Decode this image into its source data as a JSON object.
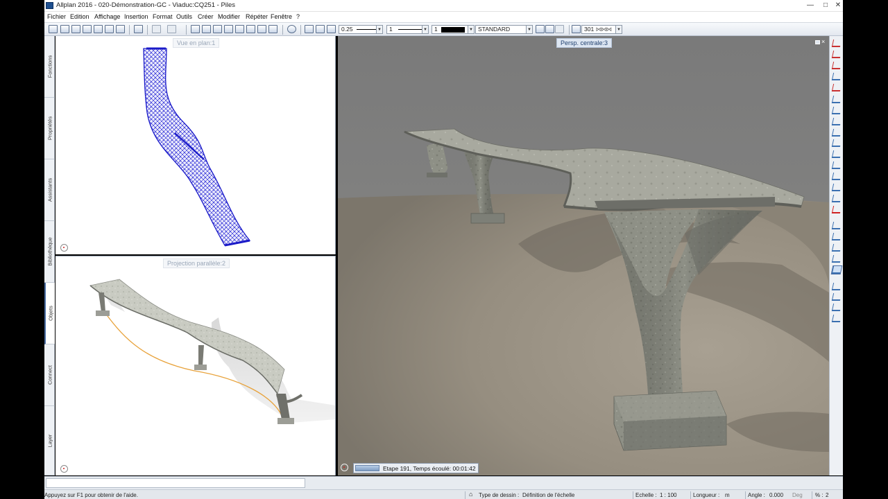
{
  "window": {
    "title": "Allplan 2016 - 020-Démonstration-GC - Viaduc:CQ251 - Piles",
    "controls": [
      "—",
      "□",
      "✕"
    ]
  },
  "menu": [
    "Fichier",
    "Edition",
    "Affichage",
    "Insertion",
    "Format",
    "Outils",
    "Créer",
    "Modifier",
    "Répéter",
    "Fenêtre",
    "?"
  ],
  "toolbar": {
    "pen_thickness": "0.25",
    "line_type": "1",
    "color_number": "1",
    "layer": "STANDARD",
    "hatch_number": "301",
    "colors": {
      "accent_blue": "#2b2bd6",
      "selection_orange": "#e8a23a"
    }
  },
  "left_tabs": [
    "Fonctions",
    "Propriétés",
    "Assistants",
    "Bibliothèque",
    "Objets",
    "Connect",
    "Layer"
  ],
  "active_left_tab": "Objets",
  "viewports": {
    "plan": {
      "label": "Vue en plan:1"
    },
    "parallel": {
      "label": "Projection parallèle:2"
    },
    "perspective": {
      "label": "Persp. centrale:3"
    }
  },
  "render": {
    "progress_text": "Etape 191, Temps écoulé: 00:01:42",
    "progress_fraction": 0.2
  },
  "right_tools": [
    "pencil-icon",
    "pencil-red-icon",
    "pen-red-icon",
    "column-icon",
    "pen-arrow-icon",
    "mirror-icon",
    "mirror-2-icon",
    "copy-icon",
    "move-icon",
    "stretch-icon",
    "table-icon",
    "table-2-icon",
    "layers-icon",
    "modify-icon",
    "window-icon",
    "delete-icon",
    "pencil-2-icon",
    "hatch-icon",
    "angle-icon",
    "rotate-icon",
    "measure-icon",
    "select-icon",
    "sigma-icon",
    "filter-icon",
    "filter-2-icon"
  ],
  "status": {
    "help": "Appuyez sur F1 pour obtenir de l'aide.",
    "drawing_type_label": "Type de dessin :",
    "drawing_type_value": "Définition de l'échelle",
    "scale_label": "Echelle :",
    "scale_value": "1 : 100",
    "length_label": "Longueur :",
    "length_value": "m",
    "angle_label": "Angle :",
    "angle_value": "0.000",
    "angle_unit": "Deg",
    "percent_label": "% :",
    "percent_value": "2"
  }
}
